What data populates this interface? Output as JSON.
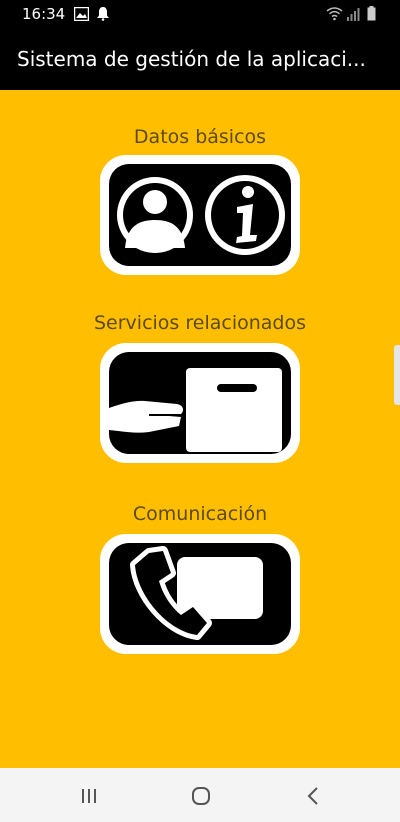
{
  "status_bar": {
    "time": "16:34",
    "left_icons": [
      "image-icon",
      "alarm-icon"
    ],
    "right_icons": [
      "wifi-icon",
      "signal-icon",
      "battery-icon"
    ]
  },
  "app_bar": {
    "title": "Sistema de gestión de la aplicaci..."
  },
  "sections": [
    {
      "label": "Datos básicos",
      "icon": "user-info-icon"
    },
    {
      "label": "Servicios relacionados",
      "icon": "service-delivery-icon"
    },
    {
      "label": "Comunicación",
      "icon": "phone-message-icon"
    }
  ],
  "nav_bar": {
    "buttons": [
      "recent-apps-icon",
      "home-icon",
      "back-icon"
    ]
  },
  "colors": {
    "background": "#FFBF00",
    "label": "#5C4A10",
    "bar": "#000000"
  }
}
